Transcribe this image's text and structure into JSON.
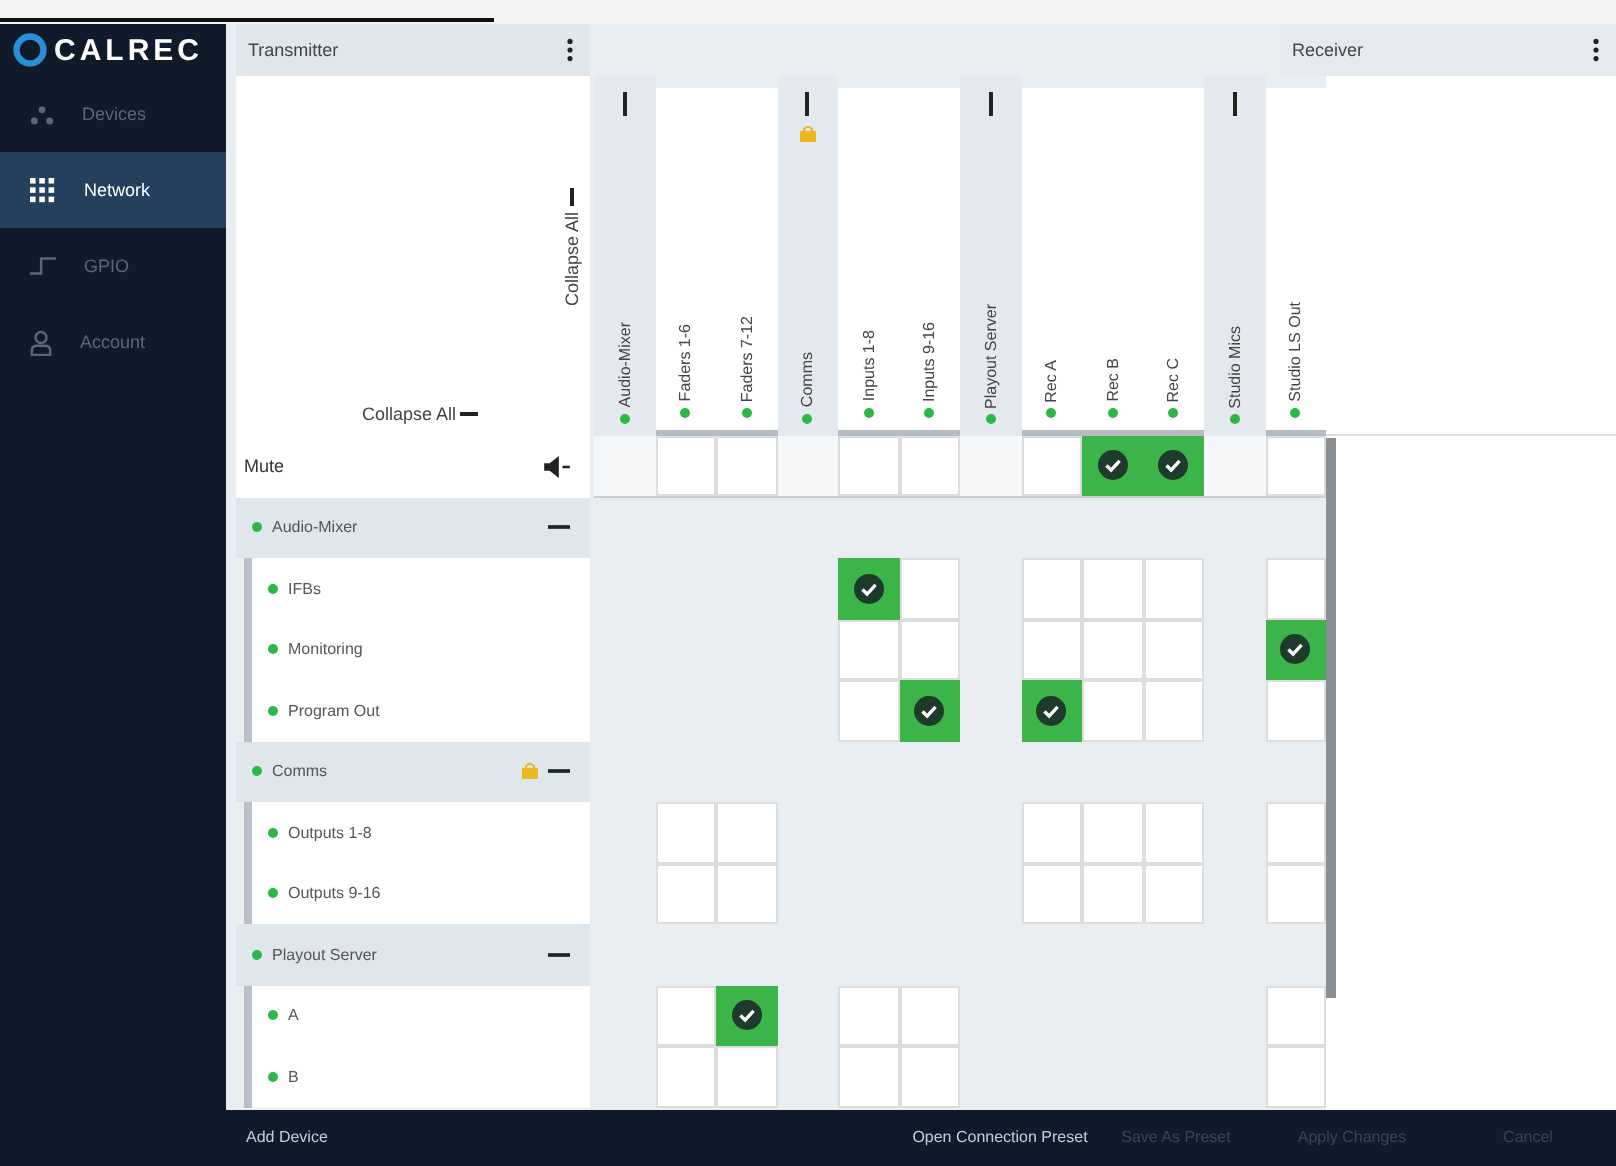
{
  "logo": "CALREC",
  "nav": [
    {
      "label": "Devices",
      "selected": false
    },
    {
      "label": "Network",
      "selected": true
    },
    {
      "label": "GPIO",
      "selected": false
    },
    {
      "label": "Account",
      "selected": false
    }
  ],
  "transmitter": {
    "title": "Transmitter",
    "collapse_vertical": "Collapse All",
    "collapse_horizontal": "Collapse All"
  },
  "receiver": {
    "title": "Receiver"
  },
  "columns": [
    {
      "kind": "group",
      "label": "Audio-Mixer",
      "locked": false
    },
    {
      "kind": "channel",
      "label": "Faders 1-6"
    },
    {
      "kind": "channel",
      "label": "Faders 7-12"
    },
    {
      "kind": "group",
      "label": "Comms",
      "locked": true
    },
    {
      "kind": "channel",
      "label": "Inputs 1-8"
    },
    {
      "kind": "channel",
      "label": "Inputs 9-16"
    },
    {
      "kind": "group",
      "label": "Playout Server",
      "locked": false
    },
    {
      "kind": "channel",
      "label": "Rec A"
    },
    {
      "kind": "channel",
      "label": "Rec B"
    },
    {
      "kind": "channel",
      "label": "Rec C"
    },
    {
      "kind": "group",
      "label": "Studio Mics",
      "locked": false
    },
    {
      "kind": "channel",
      "label": "Studio LS Out"
    }
  ],
  "rows": [
    {
      "kind": "mute",
      "label": "Mute",
      "cells": [
        {
          "kind": "none"
        },
        {
          "kind": "box",
          "checked": false
        },
        {
          "kind": "box",
          "checked": false
        },
        {
          "kind": "none"
        },
        {
          "kind": "box",
          "checked": false
        },
        {
          "kind": "box",
          "checked": false
        },
        {
          "kind": "none"
        },
        {
          "kind": "box",
          "checked": false
        },
        {
          "kind": "box",
          "checked": true
        },
        {
          "kind": "box",
          "checked": true
        },
        {
          "kind": "none"
        },
        {
          "kind": "box",
          "checked": false
        }
      ]
    },
    {
      "kind": "group",
      "label": "Audio-Mixer",
      "locked": false
    },
    {
      "kind": "channel",
      "label": "IFBs",
      "cells": [
        {
          "kind": "none"
        },
        {
          "kind": "none"
        },
        {
          "kind": "none"
        },
        {
          "kind": "none"
        },
        {
          "kind": "box",
          "checked": true
        },
        {
          "kind": "box",
          "checked": false
        },
        {
          "kind": "none"
        },
        {
          "kind": "box",
          "checked": false
        },
        {
          "kind": "box",
          "checked": false
        },
        {
          "kind": "box",
          "checked": false
        },
        {
          "kind": "none"
        },
        {
          "kind": "box",
          "checked": false
        }
      ]
    },
    {
      "kind": "channel",
      "label": "Monitoring",
      "cells": [
        {
          "kind": "none"
        },
        {
          "kind": "none"
        },
        {
          "kind": "none"
        },
        {
          "kind": "none"
        },
        {
          "kind": "box",
          "checked": false
        },
        {
          "kind": "box",
          "checked": false
        },
        {
          "kind": "none"
        },
        {
          "kind": "box",
          "checked": false
        },
        {
          "kind": "box",
          "checked": false
        },
        {
          "kind": "box",
          "checked": false
        },
        {
          "kind": "none"
        },
        {
          "kind": "box",
          "checked": true
        }
      ]
    },
    {
      "kind": "channel",
      "label": "Program Out",
      "cells": [
        {
          "kind": "none"
        },
        {
          "kind": "none"
        },
        {
          "kind": "none"
        },
        {
          "kind": "none"
        },
        {
          "kind": "box",
          "checked": false
        },
        {
          "kind": "box",
          "checked": true
        },
        {
          "kind": "none"
        },
        {
          "kind": "box",
          "checked": true
        },
        {
          "kind": "box",
          "checked": false
        },
        {
          "kind": "box",
          "checked": false
        },
        {
          "kind": "none"
        },
        {
          "kind": "box",
          "checked": false
        }
      ]
    },
    {
      "kind": "group",
      "label": "Comms",
      "locked": true
    },
    {
      "kind": "channel",
      "label": "Outputs 1-8",
      "cells": [
        {
          "kind": "none"
        },
        {
          "kind": "box",
          "checked": false
        },
        {
          "kind": "box",
          "checked": false
        },
        {
          "kind": "none"
        },
        {
          "kind": "none"
        },
        {
          "kind": "none"
        },
        {
          "kind": "none"
        },
        {
          "kind": "box",
          "checked": false
        },
        {
          "kind": "box",
          "checked": false
        },
        {
          "kind": "box",
          "checked": false
        },
        {
          "kind": "none"
        },
        {
          "kind": "box",
          "checked": false
        }
      ]
    },
    {
      "kind": "channel",
      "label": "Outputs 9-16",
      "cells": [
        {
          "kind": "none"
        },
        {
          "kind": "box",
          "checked": false
        },
        {
          "kind": "box",
          "checked": false
        },
        {
          "kind": "none"
        },
        {
          "kind": "none"
        },
        {
          "kind": "none"
        },
        {
          "kind": "none"
        },
        {
          "kind": "box",
          "checked": false
        },
        {
          "kind": "box",
          "checked": false
        },
        {
          "kind": "box",
          "checked": false
        },
        {
          "kind": "none"
        },
        {
          "kind": "box",
          "checked": false
        }
      ]
    },
    {
      "kind": "group",
      "label": "Playout Server",
      "locked": false
    },
    {
      "kind": "channel",
      "label": "A",
      "cells": [
        {
          "kind": "none"
        },
        {
          "kind": "box",
          "checked": false
        },
        {
          "kind": "box",
          "checked": true
        },
        {
          "kind": "none"
        },
        {
          "kind": "box",
          "checked": false
        },
        {
          "kind": "box",
          "checked": false
        },
        {
          "kind": "none"
        },
        {
          "kind": "none"
        },
        {
          "kind": "none"
        },
        {
          "kind": "none"
        },
        {
          "kind": "none"
        },
        {
          "kind": "box",
          "checked": false
        }
      ]
    },
    {
      "kind": "channel",
      "label": "B",
      "cells": [
        {
          "kind": "none"
        },
        {
          "kind": "box",
          "checked": false
        },
        {
          "kind": "box",
          "checked": false
        },
        {
          "kind": "none"
        },
        {
          "kind": "box",
          "checked": false
        },
        {
          "kind": "box",
          "checked": false
        },
        {
          "kind": "none"
        },
        {
          "kind": "none"
        },
        {
          "kind": "none"
        },
        {
          "kind": "none"
        },
        {
          "kind": "none"
        },
        {
          "kind": "box",
          "checked": false
        }
      ]
    }
  ],
  "footer": [
    {
      "label": "Add Device",
      "disabled": false
    },
    {
      "label": "Open Connection Preset",
      "disabled": false
    },
    {
      "label": "Save As Preset",
      "disabled": true
    },
    {
      "label": "Apply Changes",
      "disabled": true
    },
    {
      "label": "Cancel",
      "disabled": true
    }
  ]
}
